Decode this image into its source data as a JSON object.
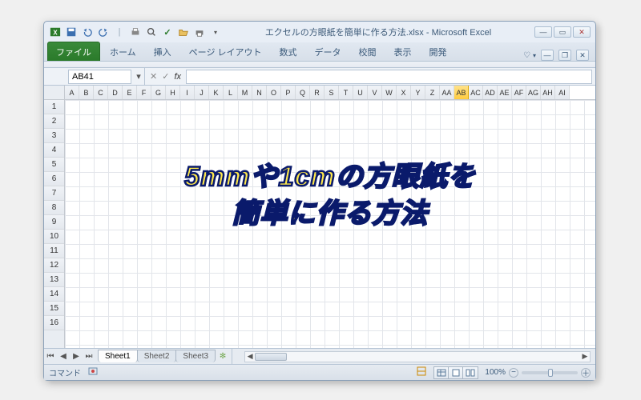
{
  "title": "エクセルの方眼紙を簡単に作る方法.xlsx - Microsoft Excel",
  "ribbon": {
    "file": "ファイル",
    "tabs": [
      "ホーム",
      "挿入",
      "ページ レイアウト",
      "数式",
      "データ",
      "校閲",
      "表示",
      "開発"
    ]
  },
  "namebox": "AB41",
  "fx_label": "fx",
  "columns": [
    "A",
    "B",
    "C",
    "D",
    "E",
    "F",
    "G",
    "H",
    "I",
    "J",
    "K",
    "L",
    "M",
    "N",
    "O",
    "P",
    "Q",
    "R",
    "S",
    "T",
    "U",
    "V",
    "W",
    "X",
    "Y",
    "Z",
    "AA",
    "AB",
    "AC",
    "AD",
    "AE",
    "AF",
    "AG",
    "AH",
    "AI"
  ],
  "selected_col": "AB",
  "rows": [
    1,
    2,
    3,
    4,
    5,
    6,
    7,
    8,
    9,
    10,
    11,
    12,
    13,
    14,
    15,
    16
  ],
  "overlay": {
    "line1": "5mmや1cmの方眼紙を",
    "line2": "簡単に作る方法"
  },
  "sheets": {
    "nav": [
      "⏮",
      "◀",
      "▶",
      "⏭"
    ],
    "tabs": [
      "Sheet1",
      "Sheet2",
      "Sheet3"
    ],
    "active": "Sheet1"
  },
  "status": {
    "mode": "コマンド",
    "zoom": "100%",
    "minus": "−",
    "plus": "＋"
  },
  "win": {
    "min": "—",
    "max": "▭",
    "close": "✕",
    "restore": "❐"
  }
}
